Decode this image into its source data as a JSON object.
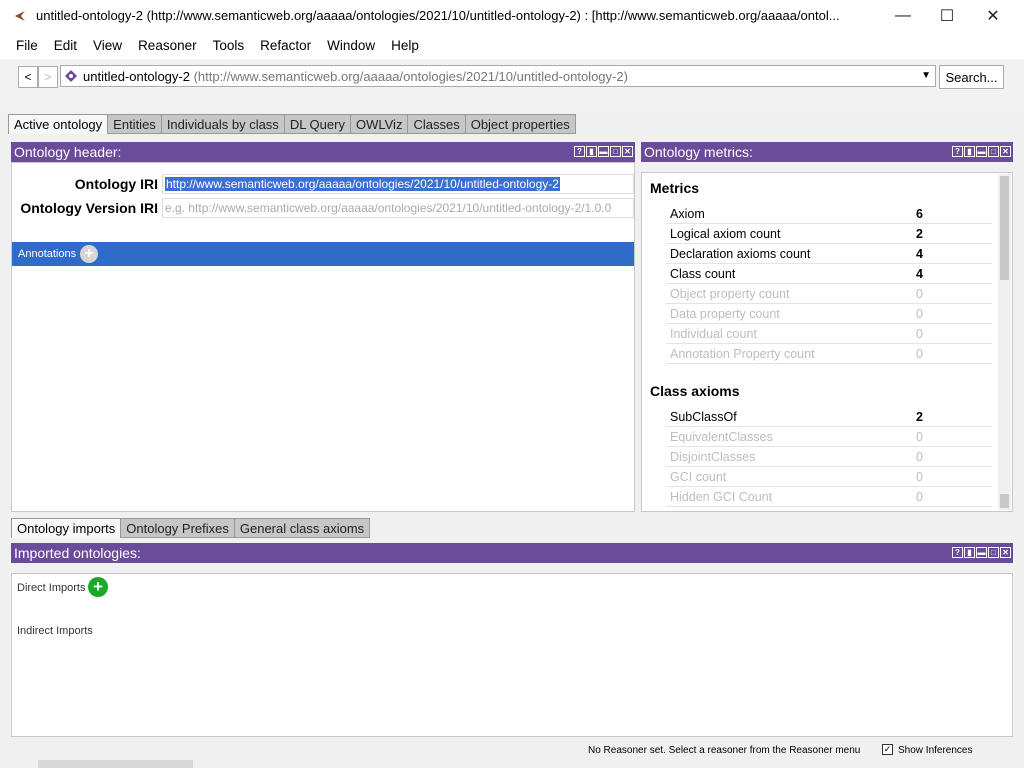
{
  "window": {
    "title": "untitled-ontology-2 (http://www.semanticweb.org/aaaaa/ontologies/2021/10/untitled-ontology-2)  : [http://www.semanticweb.org/aaaaa/ontol...",
    "minimize": "—",
    "maximize": "☐",
    "close": "✕"
  },
  "menu": [
    "File",
    "Edit",
    "View",
    "Reasoner",
    "Tools",
    "Refactor",
    "Window",
    "Help"
  ],
  "toolbar": {
    "back": "<",
    "forward": ">",
    "ontology_name": "untitled-ontology-2",
    "ontology_iri": "(http://www.semanticweb.org/aaaaa/ontologies/2021/10/untitled-ontology-2)",
    "search_label": "Search..."
  },
  "tabs": [
    "Active ontology",
    "Entities",
    "Individuals by class",
    "DL Query",
    "OWLViz",
    "Classes",
    "Object properties"
  ],
  "header_panel": {
    "title": "Ontology header:",
    "iri_label": "Ontology IRI",
    "iri_value": "http://www.semanticweb.org/aaaaa/ontologies/2021/10/untitled-ontology-2",
    "version_label": "Ontology Version IRI",
    "version_placeholder": "e.g. http://www.semanticweb.org/aaaaa/ontologies/2021/10/untitled-ontology-2/1.0.0",
    "annotations_label": "Annotations"
  },
  "metrics_panel": {
    "title": "Ontology metrics:",
    "metrics_heading": "Metrics",
    "metrics": [
      {
        "label": "Axiom",
        "value": "6"
      },
      {
        "label": "Logical axiom count",
        "value": "2"
      },
      {
        "label": "Declaration axioms count",
        "value": "4"
      },
      {
        "label": "Class count",
        "value": "4"
      },
      {
        "label": "Object property count",
        "value": "0"
      },
      {
        "label": "Data property count",
        "value": "0"
      },
      {
        "label": "Individual count",
        "value": "0"
      },
      {
        "label": "Annotation Property count",
        "value": "0"
      }
    ],
    "class_axioms_heading": "Class axioms",
    "class_axioms": [
      {
        "label": "SubClassOf",
        "value": "2"
      },
      {
        "label": "EquivalentClasses",
        "value": "0"
      },
      {
        "label": "DisjointClasses",
        "value": "0"
      },
      {
        "label": "GCI count",
        "value": "0"
      },
      {
        "label": "Hidden GCI Count",
        "value": "0"
      }
    ]
  },
  "bottom_tabs": [
    "Ontology imports",
    "Ontology Prefixes",
    "General class axioms"
  ],
  "imports_panel": {
    "title": "Imported ontologies:",
    "direct_label": "Direct Imports",
    "indirect_label": "Indirect Imports"
  },
  "status": {
    "reasoner_text": "No Reasoner set. Select a reasoner from the Reasoner menu",
    "show_inferences": "Show Inferences",
    "checked_mark": "✓"
  },
  "panel_icons": [
    "?",
    "▮",
    "▬",
    "□",
    "✕"
  ],
  "colors": {
    "panel_header": "#6b4c9a",
    "annotations_bar": "#2f6bc8",
    "selection": "#3b6fd0",
    "add_green": "#1aaa2a"
  }
}
